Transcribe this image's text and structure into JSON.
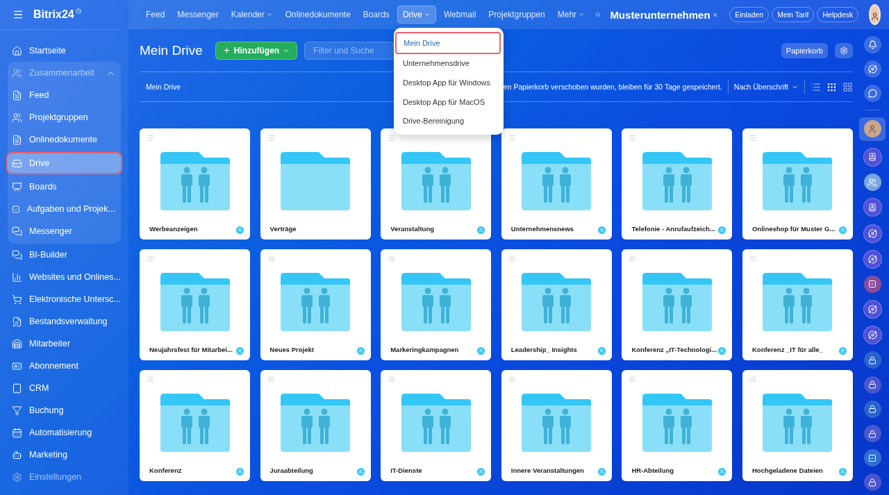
{
  "sidebar": {
    "logo": "Bitrix24",
    "items": [
      {
        "label": "Startseite",
        "selected": false
      },
      {
        "label": "Zusammenarbeit",
        "expanded": true,
        "children": [
          {
            "label": "Feed",
            "selected": false
          },
          {
            "label": "Projektgruppen",
            "selected": false
          },
          {
            "label": "Onlinedokumente",
            "selected": false
          },
          {
            "label": "Drive",
            "selected": true
          },
          {
            "label": "Boards",
            "selected": false
          },
          {
            "label": "Aufgaben und Projek...",
            "selected": false
          },
          {
            "label": "Messenger",
            "selected": false
          }
        ]
      },
      {
        "label": "BI-Builder",
        "selected": false
      },
      {
        "label": "Websites und Onlines...",
        "selected": false
      },
      {
        "label": "Elektronische Untersc...",
        "selected": false
      },
      {
        "label": "Bestandsverwaltung",
        "selected": false
      },
      {
        "label": "Mitarbeiter",
        "selected": false
      },
      {
        "label": "Abonnement",
        "selected": false
      },
      {
        "label": "CRM",
        "selected": false
      },
      {
        "label": "Buchung",
        "selected": false
      },
      {
        "label": "Automatisierung",
        "selected": false
      },
      {
        "label": "Marketing",
        "selected": false
      }
    ],
    "settings": "Einstellungen"
  },
  "top_nav": {
    "items": [
      {
        "label": "Feed",
        "selected": false,
        "dropdown": false
      },
      {
        "label": "Messenger",
        "selected": false,
        "dropdown": false
      },
      {
        "label": "Kalender",
        "selected": false,
        "dropdown": true
      },
      {
        "label": "Onlinedokumente",
        "selected": false,
        "dropdown": false
      },
      {
        "label": "Boards",
        "selected": false,
        "dropdown": false
      },
      {
        "label": "Drive",
        "selected": true,
        "dropdown": true
      },
      {
        "label": "Webmail",
        "selected": false,
        "dropdown": false
      },
      {
        "label": "Projektgruppen",
        "selected": false,
        "dropdown": false
      },
      {
        "label": "Mehr",
        "selected": false,
        "dropdown": true
      }
    ],
    "company": "Musterunternehmen",
    "buttons": [
      "Einladen",
      "Mein Tarif",
      "Helpdesk"
    ]
  },
  "drive_menu": [
    {
      "label": "Mein Drive",
      "selected": true
    },
    {
      "label": "Unternehmensdrive",
      "selected": false
    },
    {
      "label": "Desktop App für Windows",
      "selected": false
    },
    {
      "label": "Desktop App für MacOS",
      "selected": false
    },
    {
      "label": "Drive-Bereinigung",
      "selected": false
    }
  ],
  "header": {
    "title": "Mein Drive",
    "add_button": "Hinzufügen",
    "search": {
      "placeholder": "Filter und Suche"
    },
    "trash_button": "Papierkorb"
  },
  "toolbar": {
    "breadcrumb": "Mein Drive",
    "notice": "en Papierkorb verschoben wurden, bleiben für 30 Tage gespeichert.",
    "sort": "Nach Überschrift",
    "views": [
      {
        "selected": false
      },
      {
        "selected": true
      },
      {
        "selected": false
      }
    ]
  },
  "folders": [
    {
      "name": "Werbeanzeigen",
      "shared": true
    },
    {
      "name": "Verträge",
      "shared": false
    },
    {
      "name": "Veranstaltung",
      "shared": true
    },
    {
      "name": "Unternehmensnews",
      "shared": true
    },
    {
      "name": "Telefonie - Anrufaufzeich...",
      "shared": true
    },
    {
      "name": "Onlineshop für Muster G...",
      "shared": true
    },
    {
      "name": "Neujahrsfest für Mitarbei...",
      "shared": true
    },
    {
      "name": "Neues Projekt",
      "shared": true
    },
    {
      "name": "Markeringkampagnen",
      "shared": true
    },
    {
      "name": "Leadership_ Insights",
      "shared": true
    },
    {
      "name": "Konferenz „IT-Technologi...",
      "shared": true
    },
    {
      "name": "Konferenz _IT für alle_",
      "shared": true
    },
    {
      "name": "Konferenz",
      "shared": true
    },
    {
      "name": "Juraabteilung",
      "shared": true
    },
    {
      "name": "IT-Dienste",
      "shared": true
    },
    {
      "name": "Innere Veranstaltungen",
      "shared": true
    },
    {
      "name": "HR-Abteilung",
      "shared": true
    },
    {
      "name": "Hochgeladene Dateien",
      "shared": true
    }
  ],
  "right_rail": [
    {
      "kind": "bell"
    },
    {
      "kind": "copilot"
    },
    {
      "kind": "chat"
    },
    {
      "kind": "divider"
    },
    {
      "kind": "avatar",
      "selected": true
    },
    {
      "kind": "book"
    },
    {
      "kind": "group"
    },
    {
      "kind": "book"
    },
    {
      "kind": "copilot"
    },
    {
      "kind": "copilot"
    },
    {
      "kind": "task"
    },
    {
      "kind": "copilot"
    },
    {
      "kind": "copilot"
    },
    {
      "kind": "lock"
    },
    {
      "kind": "lock"
    },
    {
      "kind": "lock"
    },
    {
      "kind": "lock"
    },
    {
      "kind": "task"
    },
    {
      "kind": "lock"
    }
  ]
}
